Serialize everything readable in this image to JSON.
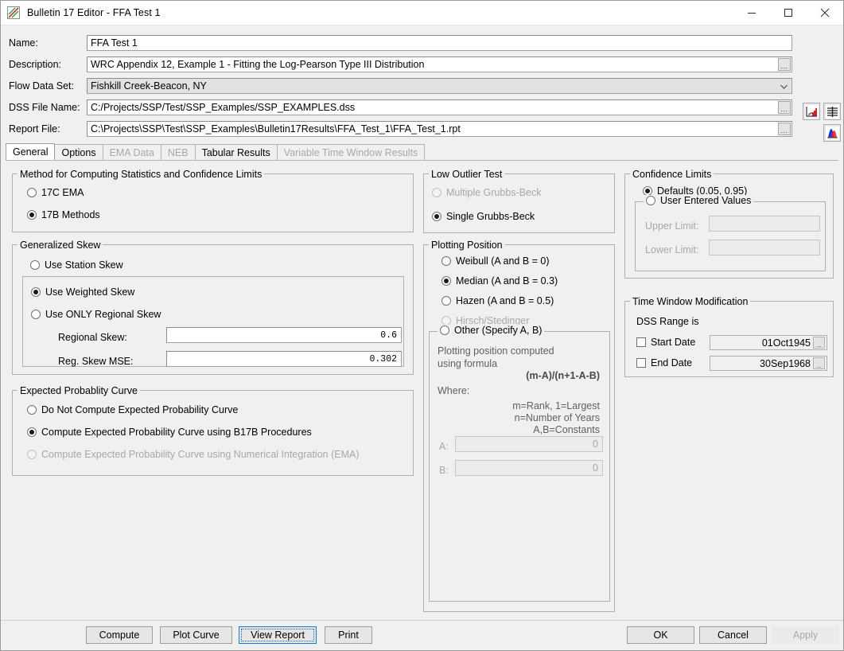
{
  "window": {
    "title": "Bulletin 17 Editor - FFA Test 1",
    "app_icon": "plot-icon",
    "controls": {
      "minimize": "minimize-icon",
      "maximize": "maximize-icon",
      "close": "close-icon"
    }
  },
  "form": {
    "rows": [
      {
        "label": "Name:",
        "value": "FFA Test 1",
        "kind": "text"
      },
      {
        "label": "Description:",
        "value": "WRC Appendix 12, Example 1 - Fitting the Log-Pearson Type III Distribution",
        "kind": "text-ellipsis"
      },
      {
        "label": "Flow Data Set:",
        "value": "Fishkill Creek-Beacon, NY",
        "kind": "combo"
      },
      {
        "label": "DSS File Name:",
        "value": "C:/Projects/SSP/Test/SSP_Examples/SSP_EXAMPLES.dss",
        "kind": "text-ellipsis"
      },
      {
        "label": "Report File:",
        "value": "C:\\Projects\\SSP\\Test\\SSP_Examples\\Bulletin17Results\\FFA_Test_1\\FFA_Test_1.rpt",
        "kind": "text-ellipsis"
      }
    ],
    "ellipsis_label": "...",
    "side_icons": [
      {
        "name": "plot-data-icon"
      },
      {
        "name": "table-data-icon"
      },
      {
        "name": "distribution-icon"
      }
    ]
  },
  "tabs": [
    {
      "label": "General",
      "selected": true,
      "enabled": true
    },
    {
      "label": "Options",
      "selected": false,
      "enabled": true
    },
    {
      "label": "EMA Data",
      "selected": false,
      "enabled": false
    },
    {
      "label": "NEB",
      "selected": false,
      "enabled": false
    },
    {
      "label": "Tabular Results",
      "selected": false,
      "enabled": true
    },
    {
      "label": "Variable Time Window Results",
      "selected": false,
      "enabled": false
    }
  ],
  "method_group": {
    "title": "Method for Computing Statistics and Confidence Limits",
    "options": [
      {
        "label": "17C EMA",
        "checked": false,
        "enabled": true
      },
      {
        "label": "17B Methods",
        "checked": true,
        "enabled": true
      }
    ]
  },
  "skew_group": {
    "title": "Generalized Skew",
    "station_option": {
      "label": "Use Station Skew",
      "checked": false,
      "enabled": true
    },
    "inner_options": [
      {
        "label": "Use Weighted Skew",
        "checked": true,
        "enabled": true
      },
      {
        "label": "Use ONLY Regional Skew",
        "checked": false,
        "enabled": true
      }
    ],
    "fields": [
      {
        "label": "Regional Skew:",
        "value": "0.6"
      },
      {
        "label": "Reg. Skew MSE:",
        "value": "0.302"
      }
    ]
  },
  "epc_group": {
    "title": "Expected Probablity Curve",
    "options": [
      {
        "label": "Do Not Compute Expected Probability Curve",
        "checked": false,
        "enabled": true
      },
      {
        "label": "Compute Expected Probability Curve using B17B Procedures",
        "checked": true,
        "enabled": true
      },
      {
        "label": "Compute Expected Probability Curve using Numerical Integration (EMA)",
        "checked": false,
        "enabled": false
      }
    ]
  },
  "low_outlier_group": {
    "title": "Low Outlier Test",
    "options": [
      {
        "label": "Multiple Grubbs-Beck",
        "checked": false,
        "enabled": false
      },
      {
        "label": "Single Grubbs-Beck",
        "checked": true,
        "enabled": true
      }
    ]
  },
  "plotting_position_group": {
    "title": "Plotting Position",
    "options": [
      {
        "label": "Weibull (A and B = 0)",
        "checked": false,
        "enabled": true
      },
      {
        "label": "Median (A and B = 0.3)",
        "checked": true,
        "enabled": true
      },
      {
        "label": "Hazen (A and B = 0.5)",
        "checked": false,
        "enabled": true
      },
      {
        "label": "Hirsch/Stedinger",
        "checked": false,
        "enabled": false
      }
    ],
    "other": {
      "label": "Other (Specify A, B)",
      "checked": false,
      "description": "Plotting position computed using formula",
      "formula": "(m-A)/(n+1-A-B)",
      "where_label": "Where:",
      "definitions": [
        "m=Rank, 1=Largest",
        "n=Number of Years",
        "A,B=Constants"
      ],
      "fields": [
        {
          "label": "A:",
          "value": "0"
        },
        {
          "label": "B:",
          "value": "0"
        }
      ]
    }
  },
  "confidence_group": {
    "title": "Confidence Limits",
    "defaults_option": {
      "label": "Defaults (0.05, 0.95)",
      "checked": true,
      "enabled": true
    },
    "user_option": {
      "label": "User Entered Values",
      "checked": false,
      "enabled": true
    },
    "fields": [
      {
        "label": "Upper Limit:",
        "value": "",
        "enabled": false
      },
      {
        "label": "Lower Limit:",
        "value": "",
        "enabled": false
      }
    ]
  },
  "time_window_group": {
    "title": "Time Window Modification",
    "range_label": "DSS Range is",
    "rows": [
      {
        "label": "Start Date",
        "checked": false,
        "value": "01Oct1945",
        "ellipsis": "..."
      },
      {
        "label": "End Date",
        "checked": false,
        "value": "30Sep1968",
        "ellipsis": "..."
      }
    ]
  },
  "buttons": {
    "left": [
      {
        "label": "Compute",
        "focused": false,
        "enabled": true
      },
      {
        "label": "Plot Curve",
        "focused": false,
        "enabled": true
      },
      {
        "label": "View Report",
        "focused": true,
        "enabled": true
      },
      {
        "label": "Print",
        "focused": false,
        "enabled": true
      }
    ],
    "right": [
      {
        "label": "OK",
        "focused": false,
        "enabled": true
      },
      {
        "label": "Cancel",
        "focused": false,
        "enabled": true
      },
      {
        "label": "Apply",
        "focused": false,
        "enabled": false
      }
    ]
  }
}
